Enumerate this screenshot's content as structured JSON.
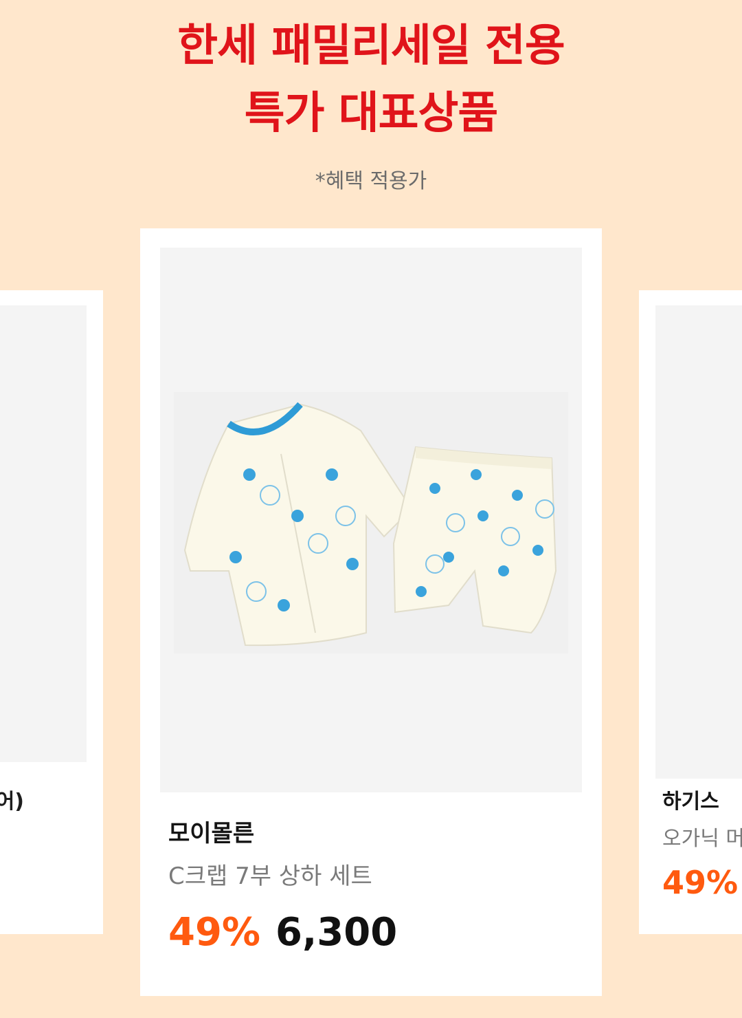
{
  "hero": {
    "title_line1": "한세 패밀리세일 전용",
    "title_line2": "특가 대표상품",
    "note": "*혜택 적용가"
  },
  "left_card": {
    "partial_text": "어)"
  },
  "center_card": {
    "brand": "모이몰른",
    "product_name": "C크랩 7부 상하 세트",
    "discount": "49%",
    "price": "6,300",
    "image_icon": "baby-pajama-set-image"
  },
  "right_card": {
    "brand": "하기스",
    "product_name": "오가닉 머",
    "discount": "49%"
  },
  "colors": {
    "background": "#FFE7CC",
    "title_red": "#E0141A",
    "discount_orange": "#FF5A0F"
  }
}
